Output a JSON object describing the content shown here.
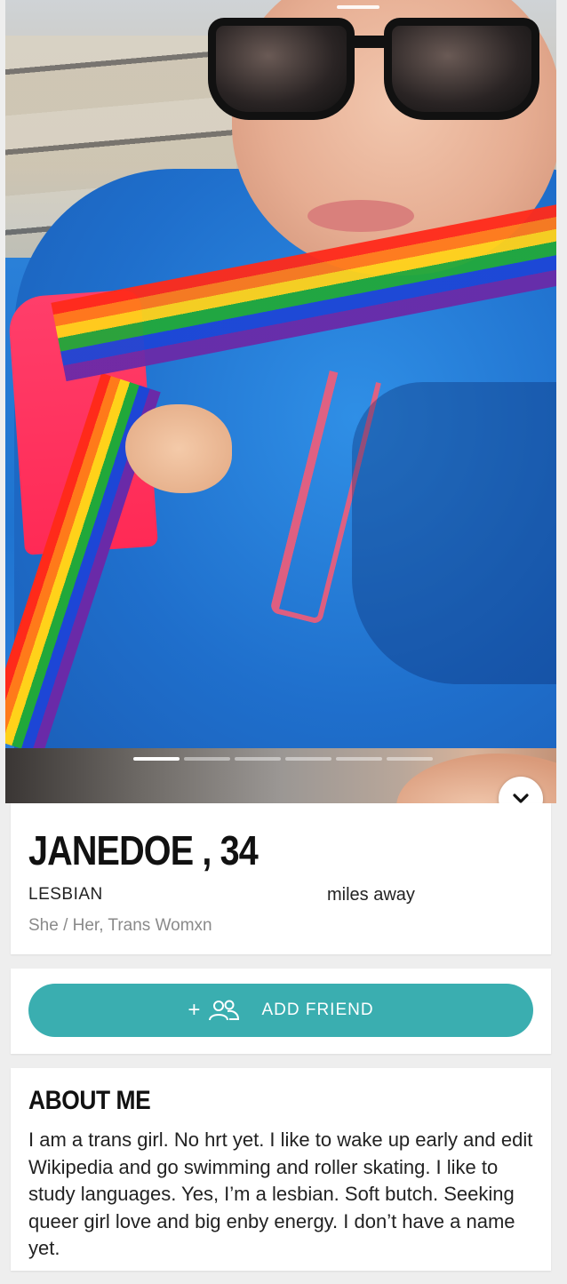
{
  "profile": {
    "name": "JANEDOE",
    "separator": " , ",
    "age": "34",
    "orientation": "LESBIAN",
    "distance_suffix": "miles away",
    "pronouns": "She / Her, Trans Womxn"
  },
  "photos": {
    "count": 6,
    "active_index": 0
  },
  "actions": {
    "add_friend_label": "ADD FRIEND",
    "add_friend_plus": "+"
  },
  "about": {
    "title": "ABOUT ME",
    "text": "I am a trans girl. No hrt yet. I like to wake up early and edit Wikipedia and go swimming and roller skating. I like to study languages. Yes, I’m a lesbian. Soft butch. Seeking queer girl love and big enby energy. I don’t have a name yet."
  },
  "colors": {
    "accent": "#3aaeb0",
    "background": "#eeeeee"
  },
  "icons": {
    "expand": "chevron-down-icon",
    "friends": "people-icon"
  }
}
